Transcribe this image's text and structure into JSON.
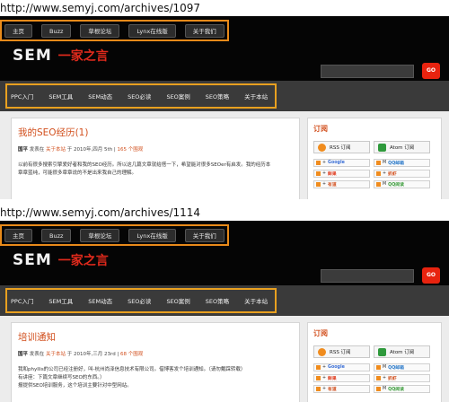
{
  "colors": {
    "accent": "#d2501e",
    "header_bg": "#050505",
    "navbar_bg": "#3a3a3a",
    "go_button": "#e8230f",
    "highlight_box": "#e8a020"
  },
  "panels": [
    {
      "url": "http://www.semyj.com/archives/1097",
      "top_nav": [
        "主页",
        "Buzz",
        "草根论坛",
        "Lynx在线版",
        "关于我们"
      ],
      "logo": {
        "sem": "SEM",
        "cn": "一家之言"
      },
      "go_label": "GO",
      "sub_nav": [
        "PPC入门",
        "SEM工具",
        "SEM动态",
        "SEO必读",
        "SEO案例",
        "SEO策略",
        "关于本站"
      ],
      "post": {
        "title": "我的SEO经历(1)",
        "meta": {
          "author": "国平",
          "posted_in": "发表在",
          "category": "关于本站",
          "date_prefix": "于 2010年,四月 5th |",
          "views": "165 个围观"
        },
        "excerpt": [
          "以前有很多搜索引擎爱好者和我的SEO经历。所以这几篇文章就给搭一下，希望能对很多SEOer有启发。我的经历本",
          "章章蓝纯，可能很多章章说的不是出来我自己的理解。"
        ]
      },
      "sidebar": {
        "title": "订阅",
        "rss": "RSS 订阅",
        "atom": "Atom 订阅",
        "subs": [
          {
            "pre": "+",
            "name": "Google",
            "color": "#3b6fd6"
          },
          {
            "pre": "M",
            "name": "QQ邮箱",
            "color": "#2a79c9"
          },
          {
            "pre": "+",
            "name": "鲜果",
            "color": "#e03a1c"
          },
          {
            "pre": "+",
            "name": "抓虾",
            "color": "#d2501e"
          },
          {
            "pre": "+",
            "name": "有道",
            "color": "#d2501e"
          },
          {
            "pre": "M",
            "name": "QQ阅读",
            "color": "#3a9b3a"
          }
        ]
      }
    },
    {
      "url": "http://www.semyj.com/archives/1114",
      "top_nav": [
        "主页",
        "Buzz",
        "草根论坛",
        "Lynx在线版",
        "关于我们"
      ],
      "logo": {
        "sem": "SEM",
        "cn": "一家之言"
      },
      "go_label": "GO",
      "sub_nav": [
        "PPC入门",
        "SEM工具",
        "SEM动态",
        "SEO必读",
        "SEO案例",
        "SEO策略",
        "关于本站"
      ],
      "post": {
        "title": "培训通知",
        "meta": {
          "author": "国平",
          "posted_in": "发表在",
          "category": "关于本站",
          "date_prefix": "于 2010年,三月 23rd |",
          "views": "68 个围观"
        },
        "excerpt": [
          "我和phyllis的公司已经注册好，叫-杭州尚泽信息技术有限公司。借博客发个培训通知。（请勿戴踩转载）",
          "有讲座：下篇文章继续写SEO的东西。）",
          "报提供SEO培训服务，这个培训主要针对中型网站。"
        ]
      },
      "sidebar": {
        "title": "订阅",
        "rss": "RSS 订阅",
        "atom": "Atom 订阅",
        "subs": [
          {
            "pre": "+",
            "name": "Google",
            "color": "#3b6fd6"
          },
          {
            "pre": "M",
            "name": "QQ邮箱",
            "color": "#2a79c9"
          },
          {
            "pre": "+",
            "name": "鲜果",
            "color": "#e03a1c"
          },
          {
            "pre": "+",
            "name": "抓虾",
            "color": "#d2501e"
          },
          {
            "pre": "+",
            "name": "有道",
            "color": "#d2501e"
          },
          {
            "pre": "M",
            "name": "QQ阅读",
            "color": "#3a9b3a"
          }
        ]
      }
    }
  ]
}
